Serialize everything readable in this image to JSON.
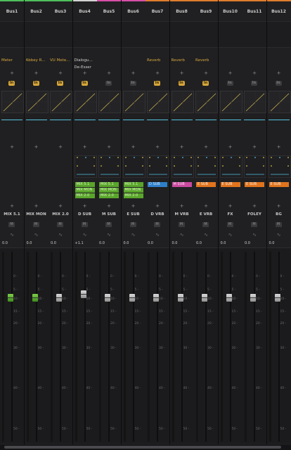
{
  "strips": [
    {
      "name": "Bus1",
      "color": "#4fbf5a",
      "plugin": "Meter",
      "plugin_style": "active",
      "plugin2": "",
      "in_on": true,
      "routes": [],
      "channel": "MIX 5.1",
      "readout": "0.0",
      "knob": "green",
      "eq": true
    },
    {
      "name": "Bus2",
      "color": "#4fbf5a",
      "plugin": "Abbey R...",
      "plugin_style": "active",
      "plugin2": "",
      "in_on": true,
      "routes": [],
      "channel": "MIX MON",
      "readout": "0.0",
      "knob": "green",
      "eq": true
    },
    {
      "name": "Bus3",
      "color": "#4fbf5a",
      "plugin": "VU Mete...",
      "plugin_style": "active",
      "plugin2": "",
      "in_on": true,
      "routes": [],
      "channel": "MIX 2.0",
      "readout": "0.0",
      "knob": "grey",
      "eq": true
    },
    {
      "name": "Bus4",
      "color": "#d2d2d2",
      "plugin": "Dialogu...",
      "plugin_style": "white",
      "plugin2": "De-Esser",
      "in_on": true,
      "routes": [
        {
          "label": "MIX 5.1",
          "color": "#5aa52b",
          "text": "#d8f5c0"
        },
        {
          "label": "MIX MON",
          "color": "#5aa52b",
          "text": "#d8f5c0"
        },
        {
          "label": "MIX 2.0",
          "color": "#5aa52b",
          "text": "#d8f5c0"
        }
      ],
      "channel": "D SUB",
      "readout": "+1.1",
      "knob": "grey",
      "eq": true
    },
    {
      "name": "Bus5",
      "color": "#d84fa8",
      "plugin": "",
      "plugin_style": "",
      "plugin2": "",
      "in_on": false,
      "routes": [
        {
          "label": "MIX 5.1",
          "color": "#5aa52b",
          "text": "#d8f5c0"
        },
        {
          "label": "MIX MON",
          "color": "#5aa52b",
          "text": "#d8f5c0"
        },
        {
          "label": "MIX 2.0",
          "color": "#5aa52b",
          "text": "#d8f5c0"
        }
      ],
      "channel": "M SUB",
      "readout": "0.0",
      "knob": "grey",
      "eq": true
    },
    {
      "name": "Bus6",
      "color": "#d84fa8",
      "plugin": "",
      "plugin_style": "",
      "plugin2": "",
      "in_on": false,
      "routes": [
        {
          "label": "MIX 5.1",
          "color": "#5aa52b",
          "text": "#d8f5c0"
        },
        {
          "label": "MIX MON",
          "color": "#5aa52b",
          "text": "#d8f5c0"
        },
        {
          "label": "MIX 2.0",
          "color": "#5aa52b",
          "text": "#d8f5c0"
        }
      ],
      "channel": "E SUB",
      "readout": "0.0",
      "knob": "grey",
      "eq": true
    },
    {
      "name": "Bus7",
      "color": "#e07d2c",
      "plugin": "Reverb",
      "plugin_style": "active",
      "plugin2": "",
      "in_on": true,
      "routes": [
        {
          "label": "D SUB",
          "color": "#2f7fc8",
          "text": "#d7ecff"
        }
      ],
      "channel": "D VRB",
      "readout": "0.0",
      "knob": "grey",
      "eq": true
    },
    {
      "name": "Bus8",
      "color": "#e07d2c",
      "plugin": "Reverb",
      "plugin_style": "active",
      "plugin2": "",
      "in_on": true,
      "routes": [
        {
          "label": "M SUB",
          "color": "#c94aa0",
          "text": "#ffe0f4"
        }
      ],
      "channel": "M VRB",
      "readout": "0.0",
      "knob": "grey",
      "eq": true
    },
    {
      "name": "Bus9",
      "color": "#e07d2c",
      "plugin": "Reverb",
      "plugin_style": "active",
      "plugin2": "",
      "in_on": true,
      "routes": [
        {
          "label": "E SUB",
          "color": "#e0741e",
          "text": "#fff0e0"
        }
      ],
      "channel": "E VRB",
      "readout": "0.0",
      "knob": "grey",
      "eq": true
    },
    {
      "name": "Bus10",
      "color": "#e07d2c",
      "plugin": "",
      "plugin_style": "",
      "plugin2": "",
      "in_on": false,
      "routes": [
        {
          "label": "E SUB",
          "color": "#e0741e",
          "text": "#fff0e0"
        }
      ],
      "channel": "FX",
      "readout": "0.0",
      "knob": "grey",
      "eq": true
    },
    {
      "name": "Bus11",
      "color": "#e07d2c",
      "plugin": "",
      "plugin_style": "",
      "plugin2": "",
      "in_on": false,
      "routes": [
        {
          "label": "E SUB",
          "color": "#e0741e",
          "text": "#fff0e0"
        }
      ],
      "channel": "FOLEY",
      "readout": "0.0",
      "knob": "grey",
      "eq": true
    },
    {
      "name": "Bus12",
      "color": "#e07d2c",
      "plugin": "",
      "plugin_style": "",
      "plugin2": "",
      "in_on": false,
      "routes": [
        {
          "label": "E SUB",
          "color": "#e0741e",
          "text": "#fff0e0"
        }
      ],
      "channel": "BG",
      "readout": "0.0",
      "knob": "grey",
      "eq": true
    }
  ],
  "labels": {
    "in": "In",
    "mute": "M",
    "add": "+"
  },
  "fader_scale": [
    "0 -",
    "5 -",
    "10 -",
    "15 -",
    "20 -",
    "30 -",
    "40 -",
    "50 -"
  ],
  "fader_levels_db": [
    -10,
    -10,
    -10,
    -8,
    -10,
    -10,
    -10,
    -10,
    -10,
    -10,
    -10,
    -10
  ]
}
